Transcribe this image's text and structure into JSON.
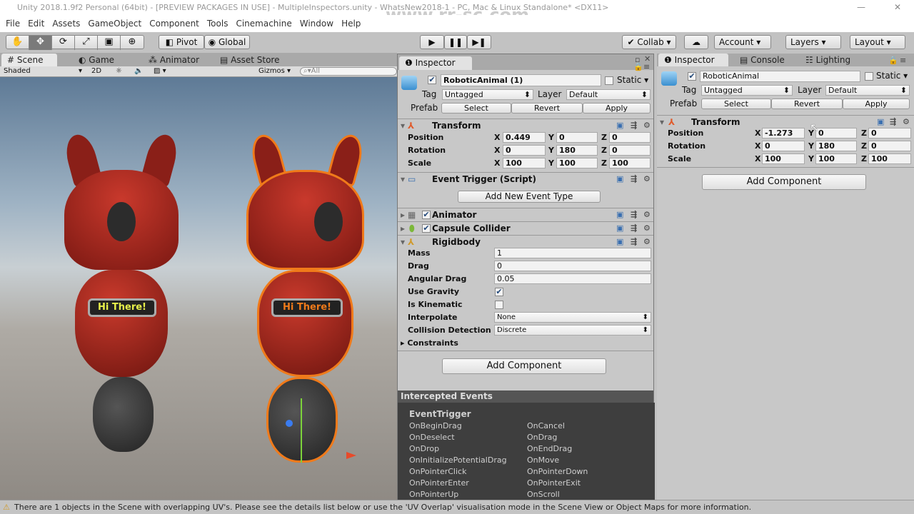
{
  "window": {
    "title": "Unity 2018.1.9f2 Personal (64bit) - [PREVIEW PACKAGES IN USE] - MultipleInspectors.unity - WhatsNew2018-1 - PC, Mac & Linux Standalone* <DX11>",
    "watermark": "www.rr-sc.com"
  },
  "menu": [
    "File",
    "Edit",
    "Assets",
    "GameObject",
    "Component",
    "Tools",
    "Cinemachine",
    "Window",
    "Help"
  ],
  "toolbar": {
    "tools": [
      "hand-tool",
      "move-tool",
      "rotate-tool",
      "scale-tool",
      "rect-tool",
      "transform-tool"
    ],
    "active_tool": "move-tool",
    "pivot": "Pivot",
    "global": "Global",
    "collab": "Collab",
    "account": "Account",
    "layers": "Layers",
    "layout": "Layout"
  },
  "left_tabs": [
    "Scene",
    "Game",
    "Animator",
    "Asset Store"
  ],
  "scenebar": {
    "shading": "Shaded",
    "mode2d": "2D",
    "gizmos": "Gizmos",
    "search_placeholder": "All"
  },
  "scene": {
    "sign_left": "Hi There!",
    "sign_right": "Hi There!"
  },
  "inspector1": {
    "tab": "Inspector",
    "name": "RoboticAnimal (1)",
    "static": "Static",
    "tag_label": "Tag",
    "tag": "Untagged",
    "layer_label": "Layer",
    "layer": "Default",
    "prefab_label": "Prefab",
    "prefab_buttons": [
      "Select",
      "Revert",
      "Apply"
    ],
    "transform": {
      "title": "Transform",
      "rows": [
        {
          "label": "Position",
          "x": "0.449",
          "y": "0",
          "z": "0"
        },
        {
          "label": "Rotation",
          "x": "0",
          "y": "180",
          "z": "0"
        },
        {
          "label": "Scale",
          "x": "100",
          "y": "100",
          "z": "100"
        }
      ]
    },
    "event_trigger": {
      "title": "Event Trigger (Script)",
      "button": "Add New Event Type"
    },
    "animator": "Animator",
    "capsule": "Capsule Collider",
    "rigidbody": {
      "title": "Rigidbody",
      "fields": [
        {
          "label": "Mass",
          "value": "1"
        },
        {
          "label": "Drag",
          "value": "0"
        },
        {
          "label": "Angular Drag",
          "value": "0.05"
        }
      ],
      "use_gravity": "Use Gravity",
      "use_gravity_checked": true,
      "is_kinematic": "Is Kinematic",
      "is_kinematic_checked": false,
      "interpolate_label": "Interpolate",
      "interpolate": "None",
      "collision_label": "Collision Detection",
      "collision": "Discrete",
      "constraints": "Constraints"
    },
    "add_component": "Add Component",
    "intercepted": {
      "title": "Intercepted Events",
      "heading": "EventTrigger",
      "col1": [
        "OnBeginDrag",
        "OnDeselect",
        "OnDrop",
        "OnInitializePotentialDrag",
        "OnPointerClick",
        "OnPointerEnter",
        "OnPointerUp"
      ],
      "col2": [
        "OnCancel",
        "OnDrag",
        "OnEndDrag",
        "OnMove",
        "OnPointerDown",
        "OnPointerExit",
        "OnScroll"
      ]
    }
  },
  "inspector2": {
    "tabs": [
      "Inspector",
      "Console",
      "Lighting"
    ],
    "name": "RoboticAnimal",
    "static": "Static",
    "tag_label": "Tag",
    "tag": "Untagged",
    "layer_label": "Layer",
    "layer": "Default",
    "prefab_label": "Prefab",
    "prefab_buttons": [
      "Select",
      "Revert",
      "Apply"
    ],
    "transform": {
      "title": "Transform",
      "rows": [
        {
          "label": "Position",
          "x": "-1.273",
          "y": "0",
          "z": "0"
        },
        {
          "label": "Rotation",
          "x": "0",
          "y": "180",
          "z": "0"
        },
        {
          "label": "Scale",
          "x": "100",
          "y": "100",
          "z": "100"
        }
      ]
    },
    "add_component": "Add Component"
  },
  "status": "There are 1 objects in the Scene with overlapping UV's. Please see the details list below or use the 'UV Overlap' visualisation mode in the Scene View or Object Maps for more information.",
  "colors": {
    "robot": "#a3231c",
    "selection": "#f07a1a",
    "sign_text": "#e8f04a"
  }
}
